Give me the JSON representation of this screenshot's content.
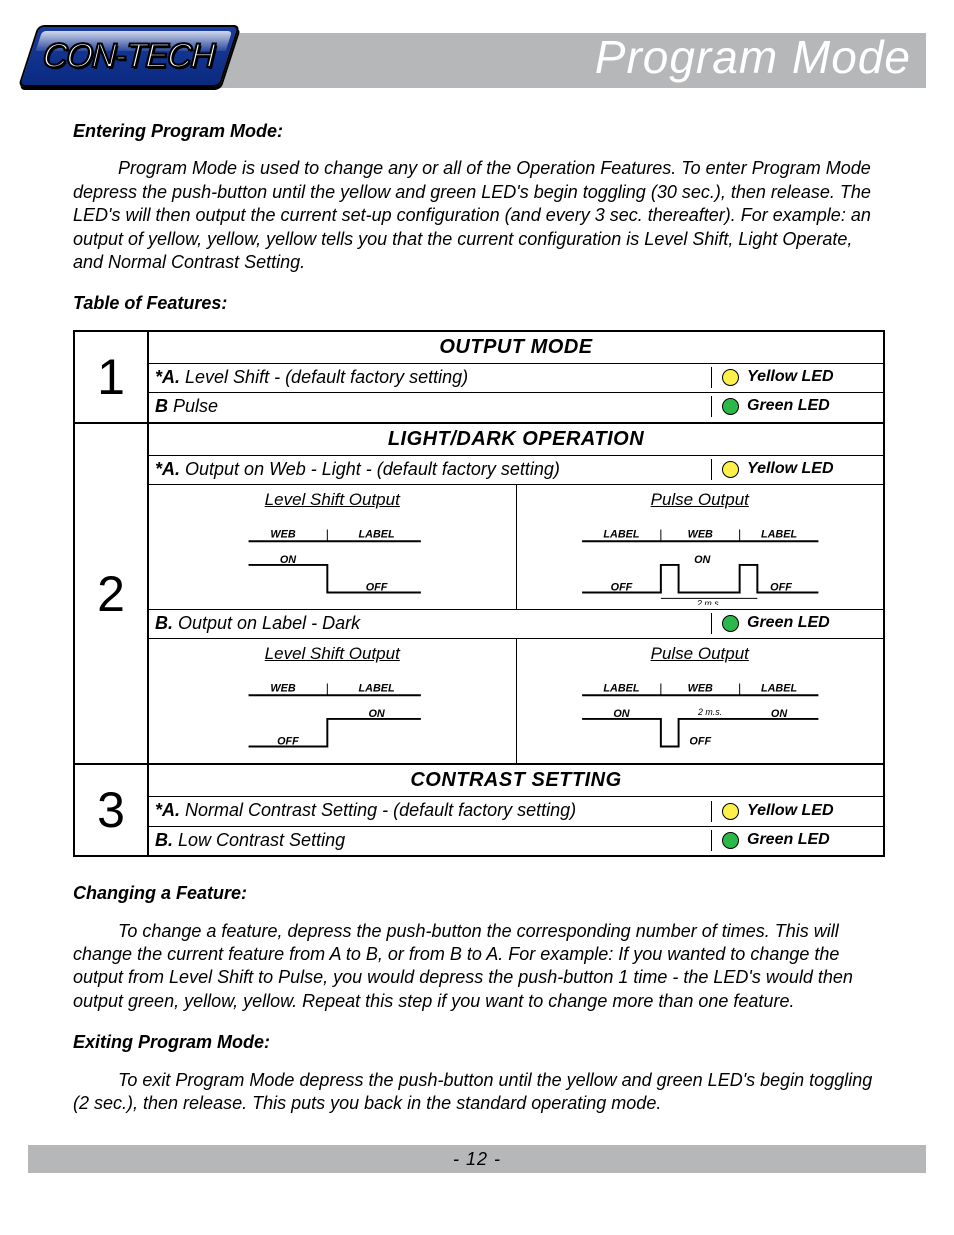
{
  "header": {
    "logo_text": "CON-TECH",
    "page_title": "Program Mode"
  },
  "sections": {
    "entering": {
      "heading": "Entering Program Mode:",
      "body": "Program Mode is used to change any or all of the Operation Features. To enter Program Mode depress the push-button until the yellow and green LED's begin toggling (30 sec.), then release. The LED's will then output the current set-up configuration (and every 3 sec. thereafter). For example: an output of yellow, yellow, yellow tells you that the current configuration is Level Shift, Light Operate, and Normal Contrast Setting."
    },
    "table_heading": "Table of Features:",
    "changing": {
      "heading": "Changing a Feature:",
      "body": "To change a feature, depress the push-button the corresponding number of times. This will change the current feature from A to B, or from B to A. For example: If you wanted to change the output from Level Shift to Pulse, you would depress the push-button 1 time - the LED's would then output green, yellow, yellow. Repeat this step if you want to change more than one feature."
    },
    "exiting": {
      "heading": "Exiting Program Mode:",
      "body": "To exit Program Mode depress the push-button until the yellow and green LED's begin toggling (2 sec.), then release. This puts you back in the standard operating mode."
    }
  },
  "table": {
    "s1": {
      "num": "1",
      "title": "OUTPUT MODE",
      "a_prefix": "*A.",
      "a_text": " Level Shift - (default factory setting)",
      "a_led": "Yellow LED",
      "b_prefix": "B",
      "b_text": " Pulse",
      "b_led": "Green LED"
    },
    "s2": {
      "num": "2",
      "title": "LIGHT/DARK OPERATION",
      "a_prefix": "*A.",
      "a_text": " Output on Web - Light - (default factory setting)",
      "a_led": "Yellow LED",
      "b_prefix": "B.",
      "b_text": " Output on Label - Dark",
      "b_led": "Green LED",
      "diag": {
        "level_shift": "Level Shift Output",
        "pulse": "Pulse Output",
        "web": "WEB",
        "label": "LABEL",
        "on": "ON",
        "off": "OFF",
        "ms": "2 m.s."
      }
    },
    "s3": {
      "num": "3",
      "title": "CONTRAST SETTING",
      "a_prefix": "*A.",
      "a_text": " Normal Contrast Setting - (default factory setting)",
      "a_led": "Yellow LED",
      "b_prefix": "B.",
      "b_text": " Low Contrast Setting",
      "b_led": "Green LED"
    }
  },
  "footer": {
    "page_number": "- 12 -"
  }
}
